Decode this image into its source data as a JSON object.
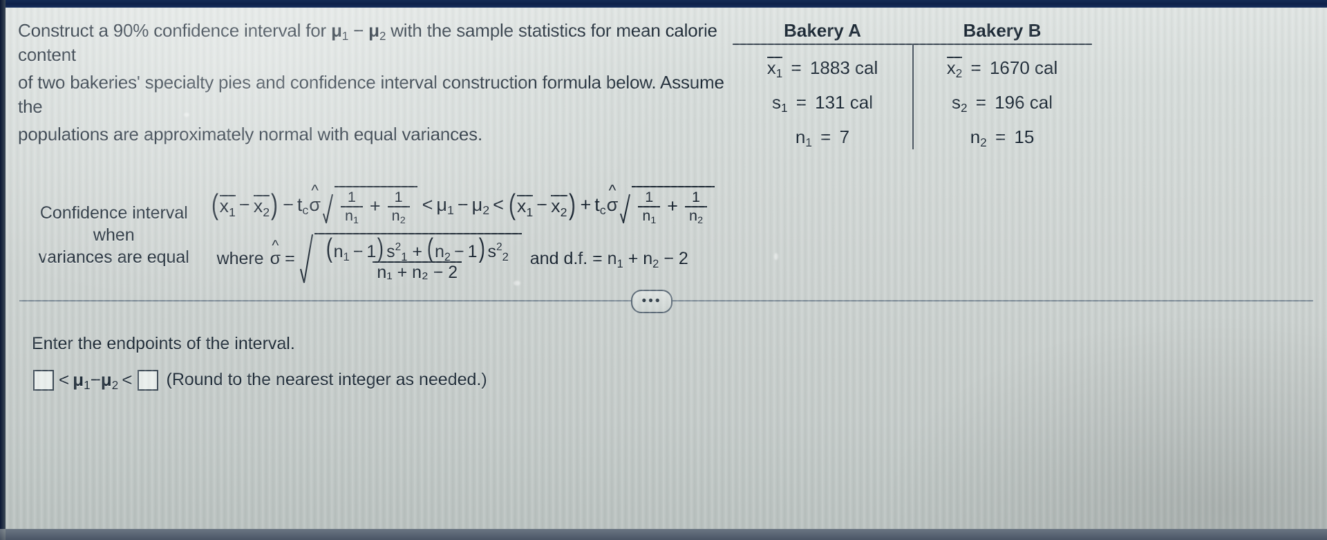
{
  "problem": {
    "line1": "Construct a 90% confidence interval for ",
    "mu1": "μ",
    "mu1_sub": "1",
    "minus": " − ",
    "mu2": "μ",
    "mu2_sub": "2",
    "line1_tail": " with the sample statistics for mean calorie content",
    "line2": "of two bakeries' specialty pies and confidence interval construction formula below. Assume the",
    "line3": "populations are approximately normal with equal variances."
  },
  "stats_table": {
    "headers": [
      "Bakery A",
      "Bakery B"
    ],
    "columns": [
      {
        "name": "Bakery A",
        "rows": [
          {
            "symbol": "x",
            "sub": "1",
            "overbar": true,
            "equals": "=",
            "value": "1883",
            "unit": "cal"
          },
          {
            "symbol": "s",
            "sub": "1",
            "overbar": false,
            "equals": "=",
            "value": "131",
            "unit": "cal"
          },
          {
            "symbol": "n",
            "sub": "1",
            "overbar": false,
            "equals": "=",
            "value": "7",
            "unit": ""
          }
        ]
      },
      {
        "name": "Bakery B",
        "rows": [
          {
            "symbol": "x",
            "sub": "2",
            "overbar": true,
            "equals": "=",
            "value": "1670",
            "unit": "cal"
          },
          {
            "symbol": "s",
            "sub": "2",
            "overbar": false,
            "equals": "=",
            "value": "196",
            "unit": "cal"
          },
          {
            "symbol": "n",
            "sub": "2",
            "overbar": false,
            "equals": "=",
            "value": "15",
            "unit": ""
          }
        ]
      }
    ]
  },
  "formula": {
    "label_line1": "Confidence interval when",
    "label_line2": "variances are equal",
    "where_label": "where",
    "sigma": "σ",
    "hat": "^",
    "equals": "=",
    "and_df_text": "and d.f. = n",
    "df_sub1": "1",
    "df_plus": " + n",
    "df_sub2": "2",
    "df_tail": " − 2",
    "one": "1",
    "n1": "n",
    "n1_sub": "1",
    "n2": "n",
    "n2_sub": "2",
    "tc": "t",
    "tc_sub": "c",
    "xbar": "x",
    "x1_sub": "1",
    "x2_sub": "2",
    "mu": "μ",
    "s_sym": "s",
    "lt": "<",
    "plus": "+",
    "minus": "−",
    "denominator": "n₁ + n₂ − 2"
  },
  "ellipsis_button": {
    "label": "•••"
  },
  "answer": {
    "prompt": "Enter the endpoints of the interval.",
    "lower_placeholder": "",
    "upper_placeholder": "",
    "lower_value": "",
    "upper_value": "",
    "lt": "<",
    "mu": "μ",
    "mu1_sub": "1",
    "mu2_sub": "2",
    "minus": " − ",
    "round_note": "(Round to the nearest integer as needed.)"
  },
  "colors": {
    "screen_bg": "#ccd2d0",
    "text": "#1d2a36",
    "rule": "#3b4753",
    "bezel": "#0e2149"
  }
}
